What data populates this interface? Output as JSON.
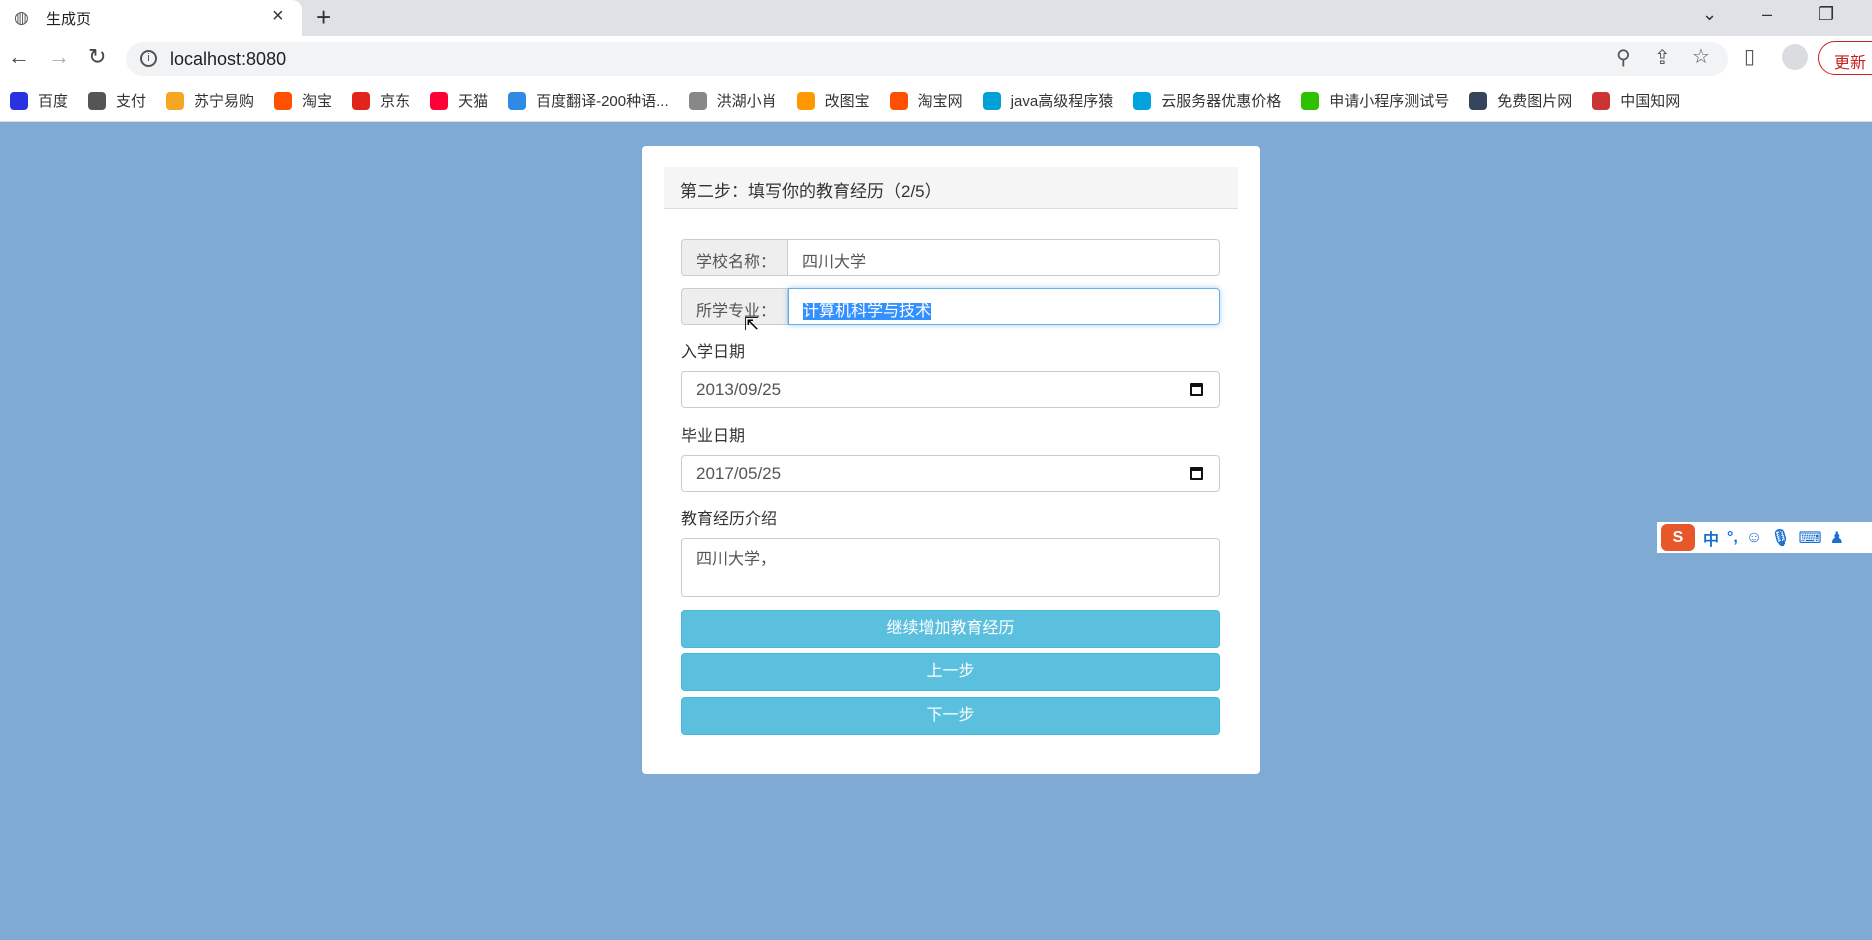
{
  "browser": {
    "tab_title": "生成页",
    "url": "localhost:8080",
    "update_label": "更新",
    "bookmarks": [
      {
        "label": "百度",
        "color": "#2932e1"
      },
      {
        "label": "支付",
        "color": "#555"
      },
      {
        "label": "苏宁易购",
        "color": "#f5a623"
      },
      {
        "label": "淘宝",
        "color": "#ff5000"
      },
      {
        "label": "京东",
        "color": "#e1251b"
      },
      {
        "label": "天猫",
        "color": "#ff0036"
      },
      {
        "label": "百度翻译-200种语...",
        "color": "#2e8ae6"
      },
      {
        "label": "洪湖小肖",
        "color": "#888"
      },
      {
        "label": "改图宝",
        "color": "#ff9800"
      },
      {
        "label": "淘宝网",
        "color": "#ff5000"
      },
      {
        "label": "java高级程序猿",
        "color": "#00a1d6"
      },
      {
        "label": "云服务器优惠价格",
        "color": "#00a3e0"
      },
      {
        "label": "申请小程序测试号",
        "color": "#2dc100"
      },
      {
        "label": "免费图片网",
        "color": "#35465c"
      },
      {
        "label": "中国知网",
        "color": "#c33"
      }
    ]
  },
  "form": {
    "heading": "第二步：填写你的教育经历（2/5）",
    "school_label": "学校名称：",
    "school_value": "四川大学",
    "major_label": "所学专业：",
    "major_value": "计算机科学与技术",
    "start_label": "入学日期",
    "start_value": "2013/09/25",
    "end_label": "毕业日期",
    "end_value": "2017/05/25",
    "intro_label": "教育经历介绍",
    "intro_value": "四川大学，",
    "add_button": "继续增加教育经历",
    "prev_button": "上一步",
    "next_button": "下一步"
  },
  "ime": {
    "mode": "中",
    "punct": "°,"
  }
}
